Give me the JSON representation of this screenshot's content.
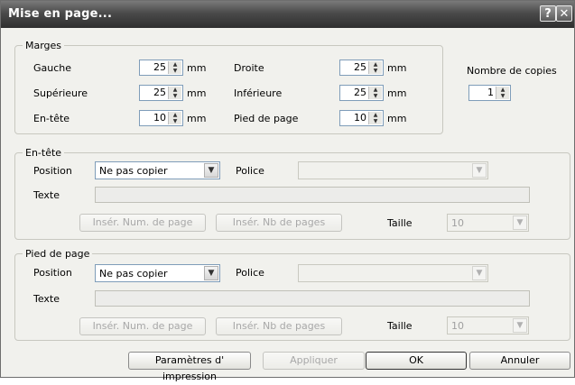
{
  "window": {
    "title": "Mise en page...",
    "help_label": "?",
    "close_label": "✕"
  },
  "margins": {
    "legend": "Marges",
    "left_label": "Gauche",
    "left_value": "25",
    "right_label": "Droite",
    "right_value": "25",
    "top_label": "Supérieure",
    "top_value": "25",
    "bottom_label": "Inférieure",
    "bottom_value": "25",
    "header_label": "En-tête",
    "header_value": "10",
    "footer_label": "Pied de page",
    "footer_value": "10",
    "unit": "mm",
    "copies_label": "Nombre de copies",
    "copies_value": "1"
  },
  "header_section": {
    "legend": "En-tête",
    "position_label": "Position",
    "position_value": "Ne pas copier",
    "font_label": "Police",
    "font_value": "",
    "text_label": "Texte",
    "text_value": "",
    "insert_page_num": "Insér. Num. de page",
    "insert_page_count": "Insér. Nb de pages",
    "size_label": "Taille",
    "size_value": "10"
  },
  "footer_section": {
    "legend": "Pied de page",
    "position_label": "Position",
    "position_value": "Ne pas copier",
    "font_label": "Police",
    "font_value": "",
    "text_label": "Texte",
    "text_value": "",
    "insert_page_num": "Insér. Num. de page",
    "insert_page_count": "Insér. Nb de pages",
    "size_label": "Taille",
    "size_value": "10"
  },
  "buttons": {
    "print_settings": "Paramètres d' impression",
    "apply": "Appliquer",
    "ok": "OK",
    "cancel": "Annuler"
  },
  "icons": {
    "spin": "spin-arrows-icon",
    "dropdown": "chevron-down-icon"
  }
}
